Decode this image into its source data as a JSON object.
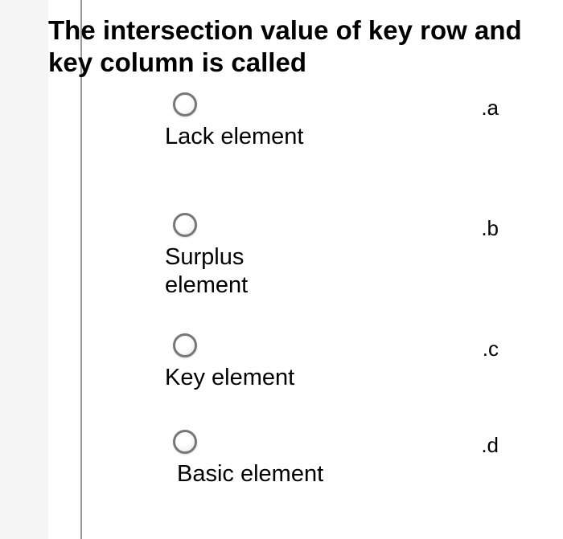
{
  "question": "The intersection value of key row and key column is called",
  "options": [
    {
      "label": "Lack element",
      "letter": ".a"
    },
    {
      "label": "Surplus element",
      "letter": ".b"
    },
    {
      "label": "Key element",
      "letter": ".c"
    },
    {
      "label": "Basic element",
      "letter": ".d"
    }
  ]
}
